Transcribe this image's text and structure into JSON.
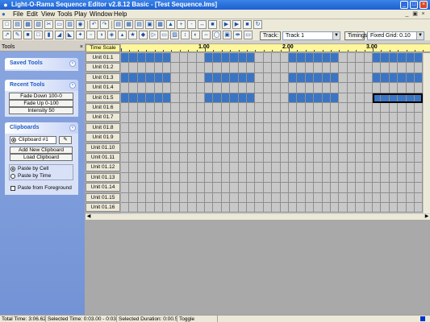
{
  "window": {
    "title": "Light-O-Rama Sequence Editor v2.8.12 Basic - [Test Sequence.lms]"
  },
  "menu": [
    "File",
    "Edit",
    "View",
    "Tools",
    "Play",
    "Window",
    "Help"
  ],
  "controls": {
    "track_label": "Track:",
    "track_value": "Track 1",
    "timings_label": "Timings",
    "grid_value": "Fixed Grid: 0.10"
  },
  "tools_pane": {
    "header": "Tools",
    "saved_tools": {
      "title": "Saved Tools"
    },
    "recent_tools": {
      "title": "Recent Tools",
      "items": [
        "Fade Down 100-0",
        "Fade Up 0-100",
        "Intensity 50"
      ]
    },
    "clipboards": {
      "title": "Clipboards",
      "current": "Clipboard #1",
      "add_label": "Add New Clipboard",
      "load_label": "Load Clipboard",
      "paste_by_cell": "Paste by Cell",
      "paste_by_time": "Paste by Time",
      "paste_foreground": "Paste from Foreground"
    }
  },
  "sequence": {
    "timescale_label": "Time Scale",
    "ruler_labels": [
      "1.00",
      "2.00",
      "3.00"
    ],
    "channels": [
      "Unit 01.1",
      "Unit 01.2",
      "Unit 01.3",
      "Unit 01.4",
      "Unit 01.5",
      "Unit 01.6",
      "Unit 01.7",
      "Unit 01.8",
      "Unit 01.9",
      "Unit 01.10",
      "Unit 01.11",
      "Unit 01.12",
      "Unit 01.13",
      "Unit 01.14",
      "Unit 01.15",
      "Unit 01.16"
    ],
    "visible_cells": 36,
    "cells_per_second": 10,
    "lit_ranges": [
      {
        "channel": 0,
        "from": 0,
        "to": 5
      },
      {
        "channel": 0,
        "from": 10,
        "to": 15
      },
      {
        "channel": 0,
        "from": 20,
        "to": 25
      },
      {
        "channel": 0,
        "from": 30,
        "to": 35
      },
      {
        "channel": 2,
        "from": 0,
        "to": 5
      },
      {
        "channel": 2,
        "from": 10,
        "to": 15
      },
      {
        "channel": 2,
        "from": 20,
        "to": 25
      },
      {
        "channel": 2,
        "from": 30,
        "to": 35
      },
      {
        "channel": 4,
        "from": 0,
        "to": 5
      },
      {
        "channel": 4,
        "from": 10,
        "to": 15
      },
      {
        "channel": 4,
        "from": 20,
        "to": 25
      }
    ],
    "selection": {
      "channel": 4,
      "from": 30,
      "to": 35
    }
  },
  "status": {
    "total_time": "Total Time: 3:06.62",
    "selected_time": "Selected Time: 0:03.00 - 0:03.50",
    "selected_duration": "Selected Duration: 0:00.50",
    "mode": "Toggle"
  },
  "colors": {
    "cell_on": "#3a75c4",
    "ruler": "#fff799",
    "panel": "#7b9ad9"
  }
}
